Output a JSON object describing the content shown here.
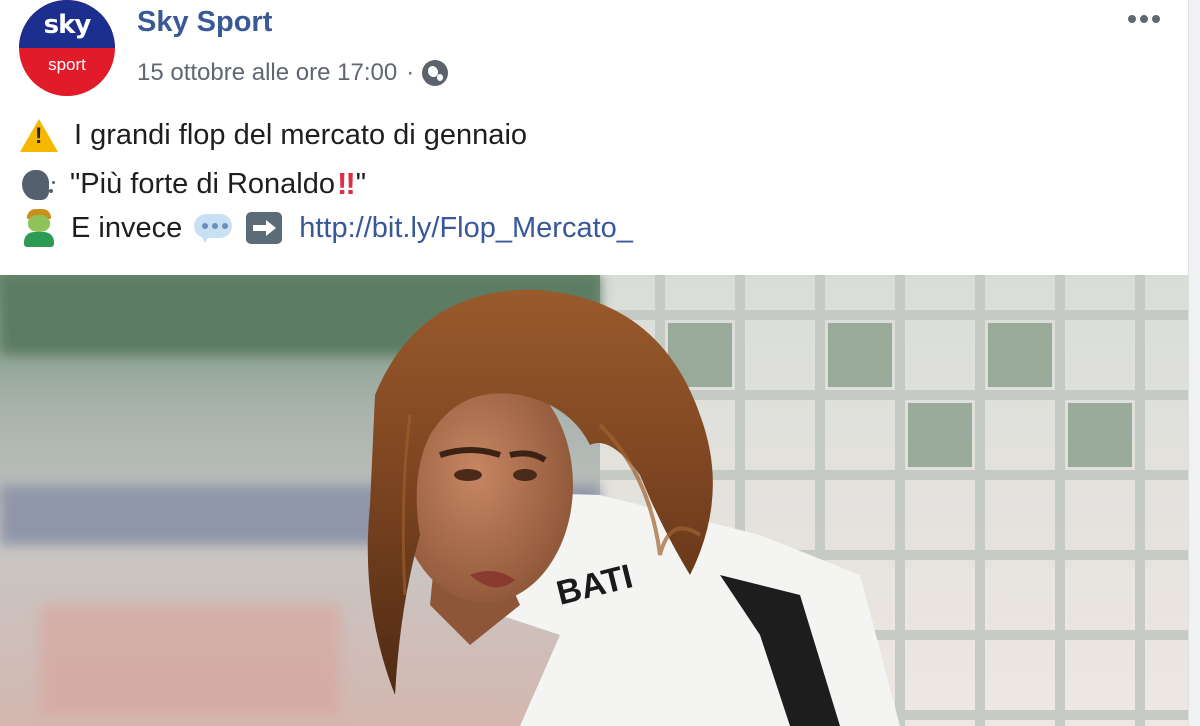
{
  "post": {
    "page_name": "Sky Sport",
    "avatar": {
      "brand": "sky",
      "sub": "sport",
      "top_color": "#1c2f8f",
      "bottom_color": "#e21b2b"
    },
    "timestamp": "15 ottobre alle ore 17:00",
    "separator": "·",
    "audience_icon": "globe-icon",
    "menu_icon": "more-options-icon",
    "lines": [
      {
        "icon": "warning-icon",
        "text": "I grandi flop del mercato di gennaio"
      },
      {
        "icon": "speaking-head-icon",
        "text_before": "\"Più forte di Ronaldo",
        "emphasis_icon": "double-exclamation-icon",
        "emphasis": "‼",
        "text_after": "\""
      },
      {
        "icon": "nauseated-person-icon",
        "text": "E invece",
        "icon2": "speech-bubble-icon",
        "icon3": "right-arrow-icon",
        "link": "http://bit.ly/Flop_Mercato_"
      }
    ],
    "link_color": "#385898",
    "image_name": "footballer-photo",
    "jersey_text": "BATI"
  }
}
